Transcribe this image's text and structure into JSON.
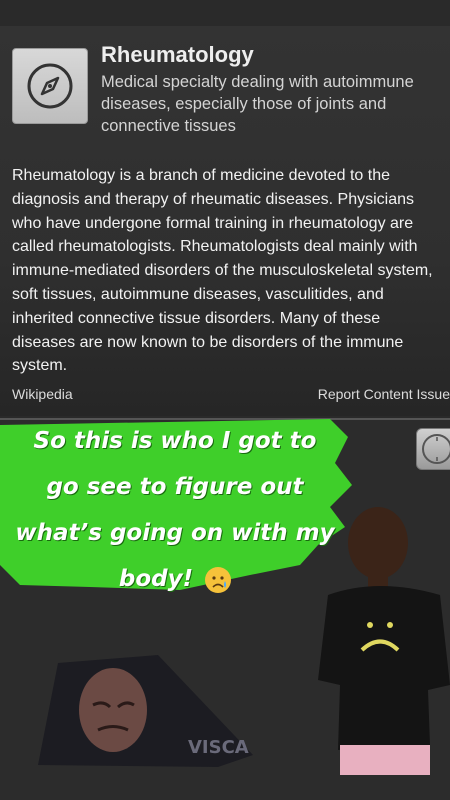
{
  "card": {
    "title": "Rheumatology",
    "subtitle": "Medical specialty dealing with autoimmune diseases, especially those of joints and connective tissues",
    "body": "Rheumatology is a branch of medicine devoted to the diagnosis and therapy of rheumatic diseases. Physicians who have undergone formal training in rheumatology are called rheumatologists. Rheumatologists deal mainly with immune-mediated disorders of the musculoskeletal system, soft tissues, autoimmune diseases, vasculitides, and inherited connective tissue disorders. Many of these diseases are now known to be disorders of the immune system.",
    "source": "Wikipedia",
    "report": "Report Content Issue",
    "icon": "compass-icon"
  },
  "caption": {
    "line1": "So this is who I got to",
    "line2": "go see to figure out",
    "line3": "what’s going on with my",
    "line4": "body!",
    "emoji": "crying-face-emoji"
  },
  "stickers": {
    "person_shirt_icon": "frowning-face-shirt",
    "crying_label": "VISCA"
  },
  "colors": {
    "splash_green": "#3fcf2a",
    "card_bg": "#333333"
  }
}
